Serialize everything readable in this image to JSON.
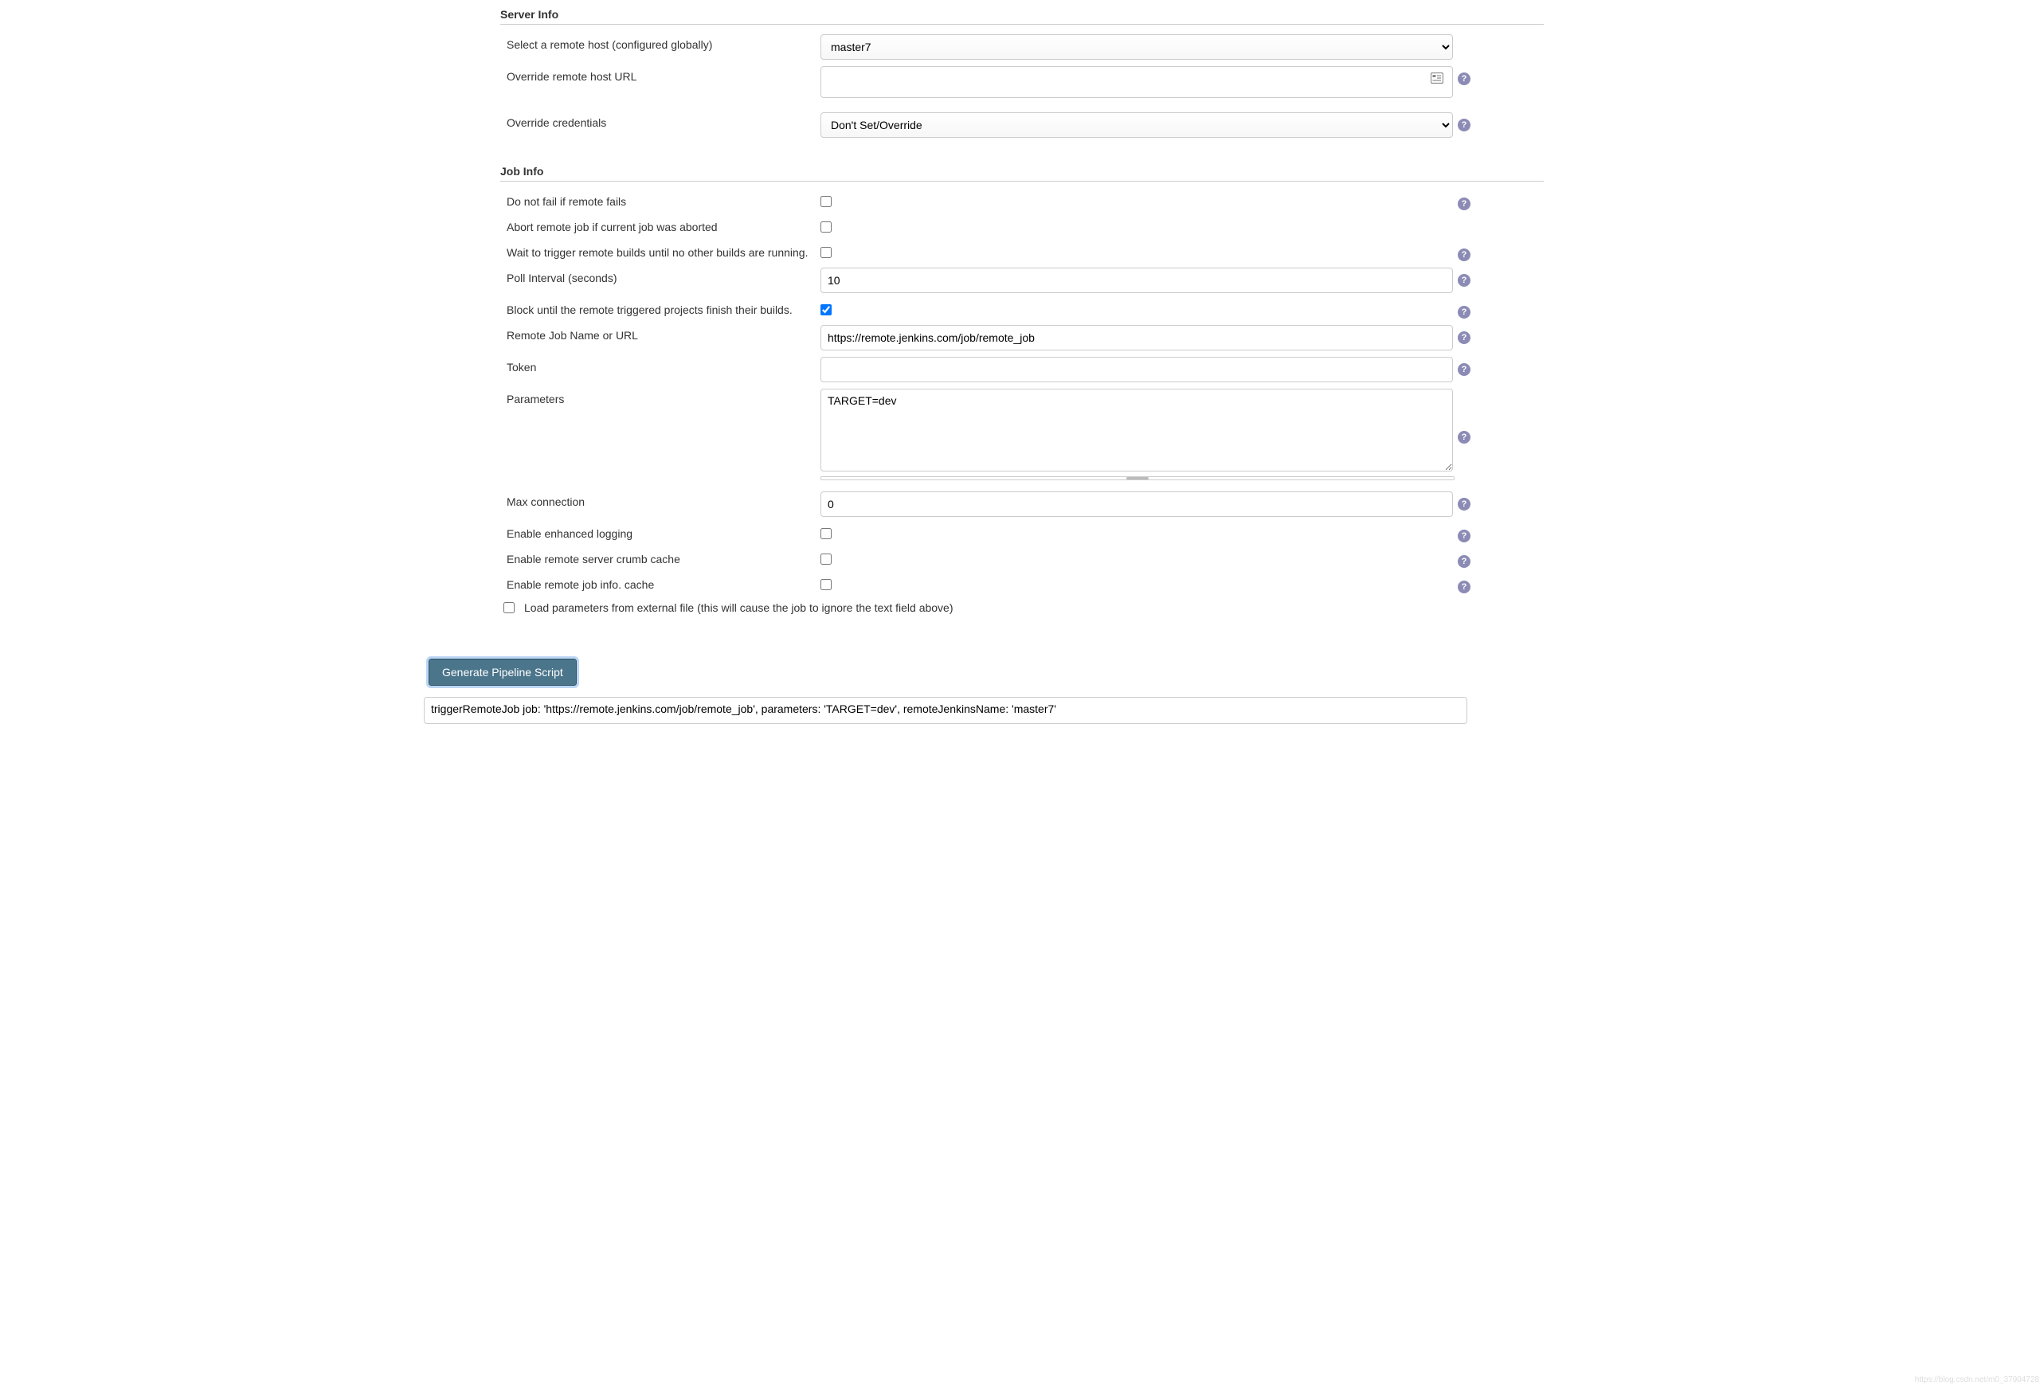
{
  "serverInfo": {
    "title": "Server Info",
    "selectHostLabel": "Select a remote host (configured globally)",
    "selectHostValue": "master7",
    "overrideUrlLabel": "Override remote host URL",
    "overrideUrlValue": "",
    "overrideCredentialsLabel": "Override credentials",
    "overrideCredentialsValue": "Don't Set/Override"
  },
  "jobInfo": {
    "title": "Job Info",
    "doNotFailLabel": "Do not fail if remote fails",
    "doNotFailChecked": false,
    "abortRemoteLabel": "Abort remote job if current job was aborted",
    "abortRemoteChecked": false,
    "waitTriggerLabel": "Wait to trigger remote builds until no other builds are running.",
    "waitTriggerChecked": false,
    "pollIntervalLabel": "Poll Interval (seconds)",
    "pollIntervalValue": "10",
    "blockUntilLabel": "Block until the remote triggered projects finish their builds.",
    "blockUntilChecked": true,
    "remoteJobNameLabel": "Remote Job Name or URL",
    "remoteJobNameValue": "https://remote.jenkins.com/job/remote_job",
    "tokenLabel": "Token",
    "tokenValue": "",
    "parametersLabel": "Parameters",
    "parametersValue": "TARGET=dev",
    "maxConnectionLabel": "Max connection",
    "maxConnectionValue": "0",
    "enhancedLoggingLabel": "Enable enhanced logging",
    "enhancedLoggingChecked": false,
    "crumbCacheLabel": "Enable remote server crumb cache",
    "crumbCacheChecked": false,
    "jobInfoCacheLabel": "Enable remote job info. cache",
    "jobInfoCacheChecked": false,
    "loadExternalLabel": "Load parameters from external file (this will cause the job to ignore the text field above)",
    "loadExternalChecked": false
  },
  "generateButtonLabel": "Generate Pipeline Script",
  "scriptOutput": "triggerRemoteJob job: 'https://remote.jenkins.com/job/remote_job', parameters: 'TARGET=dev', remoteJenkinsName: 'master7'",
  "watermark": "https://blog.csdn.net/m0_37904728"
}
